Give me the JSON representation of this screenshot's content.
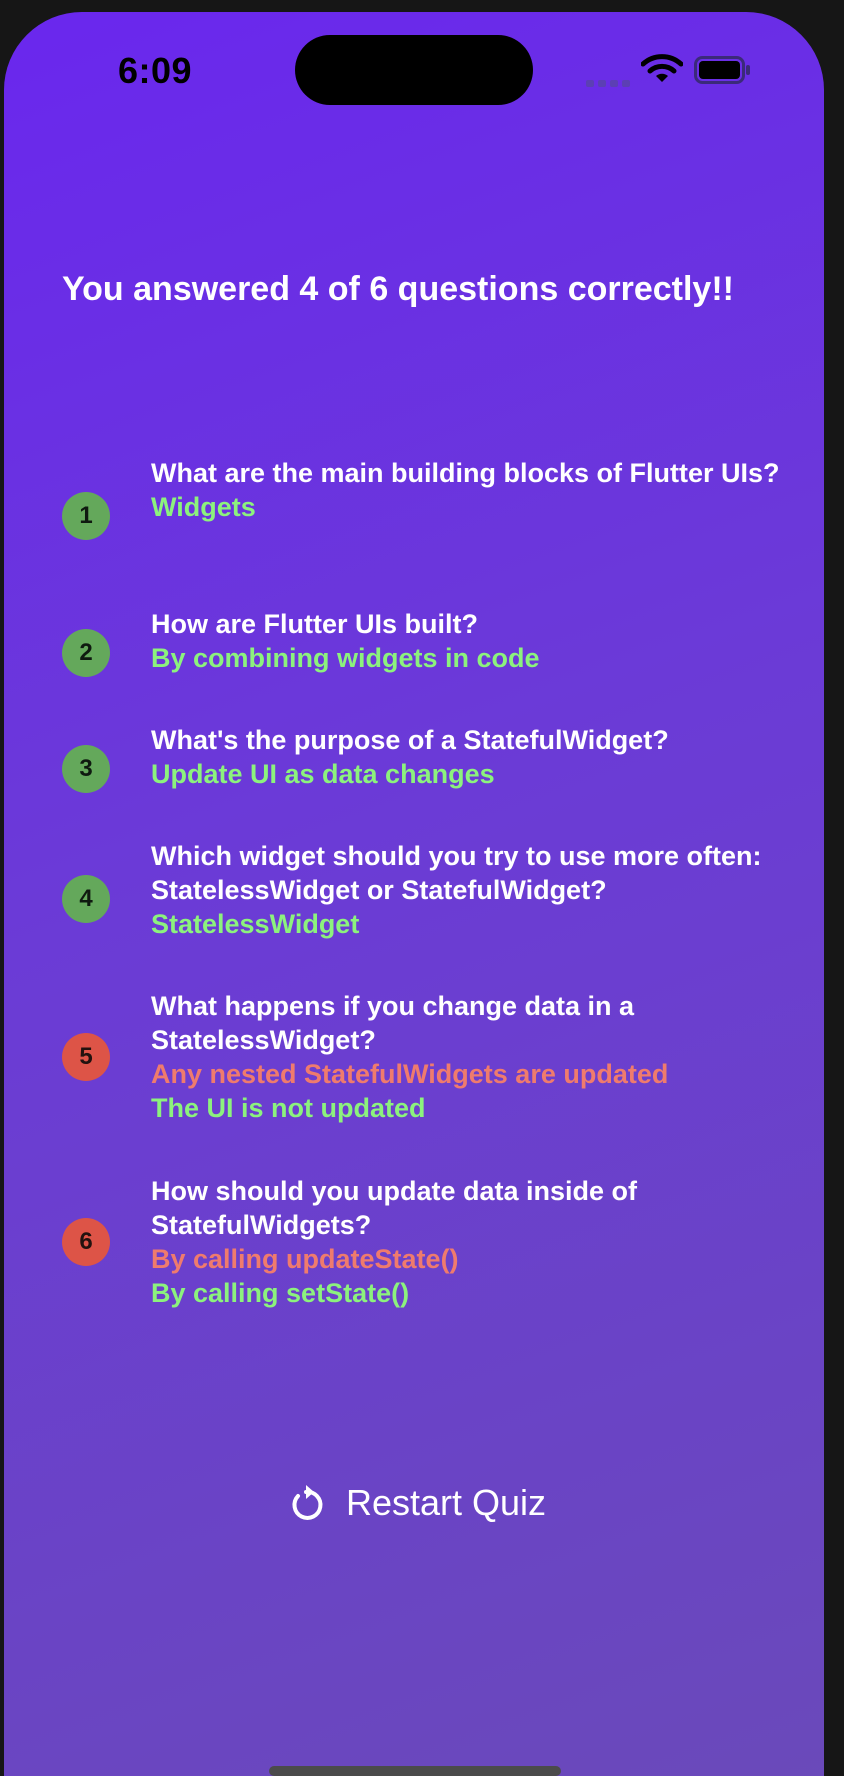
{
  "status_bar": {
    "time": "6:09",
    "icons": [
      "signal-icon",
      "wifi-icon",
      "battery-icon"
    ]
  },
  "results": {
    "headline": "You answered 4 of 6 questions correctly!!",
    "items": [
      {
        "index": "1",
        "question": "What are the main building blocks of Flutter UIs?",
        "user_answer": "Widgets",
        "correct_answer": "Widgets",
        "is_correct": true
      },
      {
        "index": "2",
        "question": "How are Flutter UIs built?",
        "user_answer": "By combining widgets in code",
        "correct_answer": "By combining widgets in code",
        "is_correct": true
      },
      {
        "index": "3",
        "question": "What's the purpose of a StatefulWidget?",
        "user_answer": "Update UI as data changes",
        "correct_answer": "Update UI as data changes",
        "is_correct": true
      },
      {
        "index": "4",
        "question": "Which widget should you try to use more often: StatelessWidget or StatefulWidget?",
        "user_answer": "StatelessWidget",
        "correct_answer": "StatelessWidget",
        "is_correct": true
      },
      {
        "index": "5",
        "question": "What happens if you change data in a StatelessWidget?",
        "user_answer": "Any nested StatefulWidgets are updated",
        "correct_answer": "The UI is not updated",
        "is_correct": false
      },
      {
        "index": "6",
        "question": "How should you update data inside of StatefulWidgets?",
        "user_answer": "By calling updateState()",
        "correct_answer": "By calling setState()",
        "is_correct": false
      }
    ]
  },
  "restart": {
    "label": "Restart Quiz",
    "icon": "restart-icon"
  },
  "colors": {
    "gradient_start": "#6a27ee",
    "gradient_end": "#6a4ab9",
    "correct_badge": "#64a85b",
    "wrong_badge": "#dd5447",
    "correct_answer_text": "#8cf27d",
    "wrong_answer_text": "#ef7b6d"
  }
}
